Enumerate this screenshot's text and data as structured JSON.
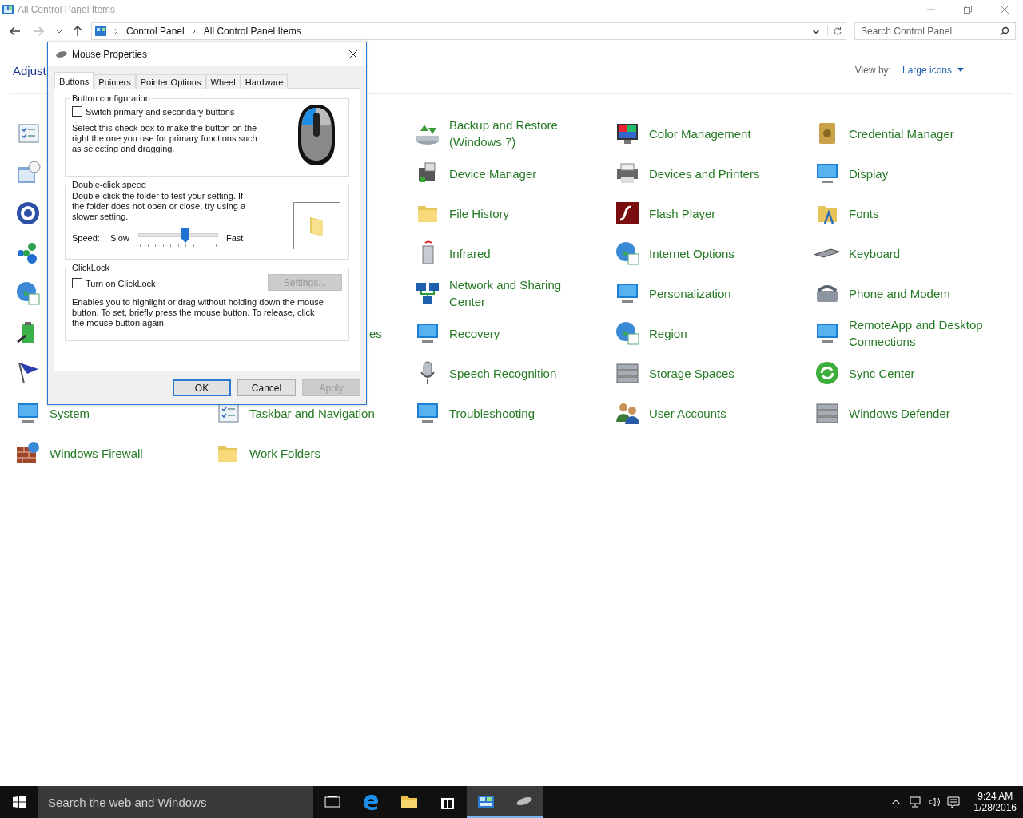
{
  "window": {
    "title": "All Control Panel Items"
  },
  "address_bar": {
    "path": [
      "Control Panel",
      "All Control Panel Items"
    ]
  },
  "search": {
    "placeholder": "Search Control Panel"
  },
  "heading": "Adjust",
  "view_by": {
    "label": "View by:",
    "value": "Large icons"
  },
  "rows": [
    {
      "cells": [
        {
          "kind": "icon_only"
        },
        {
          "kind": "covered"
        },
        {
          "kind": "item",
          "label": "Backup and Restore (Windows 7)"
        },
        {
          "kind": "item",
          "label": "Color Management"
        },
        {
          "kind": "item",
          "label": "Credential Manager"
        }
      ]
    },
    {
      "cells": [
        {
          "kind": "icon_only"
        },
        {
          "kind": "covered"
        },
        {
          "kind": "item",
          "label": "Device Manager"
        },
        {
          "kind": "item",
          "label": "Devices and Printers"
        },
        {
          "kind": "item",
          "label": "Display"
        }
      ]
    },
    {
      "cells": [
        {
          "kind": "icon_only"
        },
        {
          "kind": "covered"
        },
        {
          "kind": "item",
          "label": "File History"
        },
        {
          "kind": "item",
          "label": "Flash Player"
        },
        {
          "kind": "item",
          "label": "Fonts"
        }
      ]
    },
    {
      "cells": [
        {
          "kind": "icon_only"
        },
        {
          "kind": "covered"
        },
        {
          "kind": "item",
          "label": "Infrared"
        },
        {
          "kind": "item",
          "label": "Internet Options"
        },
        {
          "kind": "item",
          "label": "Keyboard"
        }
      ]
    },
    {
      "cells": [
        {
          "kind": "icon_only"
        },
        {
          "kind": "covered"
        },
        {
          "kind": "item",
          "label": "Network and Sharing Center"
        },
        {
          "kind": "item",
          "label": "Personalization"
        },
        {
          "kind": "item",
          "label": "Phone and Modem"
        }
      ]
    },
    {
      "cells": [
        {
          "kind": "icon_only"
        },
        {
          "kind": "cut_label",
          "label": "es"
        },
        {
          "kind": "item",
          "label": "Recovery"
        },
        {
          "kind": "item",
          "label": "Region"
        },
        {
          "kind": "item",
          "label": "RemoteApp and Desktop Connections"
        }
      ]
    },
    {
      "cells": [
        {
          "kind": "icon_only"
        },
        {
          "kind": "covered"
        },
        {
          "kind": "item",
          "label": "Speech Recognition"
        },
        {
          "kind": "item",
          "label": "Storage Spaces"
        },
        {
          "kind": "item",
          "label": "Sync Center"
        }
      ]
    },
    {
      "cells": [
        {
          "kind": "item",
          "label": "System"
        },
        {
          "kind": "item",
          "label": "Taskbar and Navigation"
        },
        {
          "kind": "item",
          "label": "Troubleshooting"
        },
        {
          "kind": "item",
          "label": "User Accounts"
        },
        {
          "kind": "item",
          "label": "Windows Defender"
        }
      ]
    },
    {
      "cells": [
        {
          "kind": "item",
          "label": "Windows Firewall"
        },
        {
          "kind": "item",
          "label": "Work Folders"
        }
      ]
    }
  ],
  "dialog": {
    "title": "Mouse Properties",
    "tabs": [
      {
        "label": "Buttons",
        "selected": true
      },
      {
        "label": "Pointers",
        "selected": false
      },
      {
        "label": "Pointer Options",
        "selected": false
      },
      {
        "label": "Wheel",
        "selected": false
      },
      {
        "label": "Hardware",
        "selected": false
      }
    ],
    "button_configuration": {
      "title": "Button configuration",
      "checkbox": {
        "label": "Switch primary and secondary buttons",
        "checked": false
      },
      "description": "Select this check box to make the button on the right the one you use for primary functions such as selecting and dragging."
    },
    "double_click_speed": {
      "title": "Double-click speed",
      "description": "Double-click the folder to test your setting. If the folder does not open or close, try using a slower setting.",
      "speed_label": "Speed:",
      "slow": "Slow",
      "fast": "Fast",
      "level": 0.59
    },
    "clicklock": {
      "title": "ClickLock",
      "checkbox": {
        "label": "Turn on ClickLock",
        "checked": false
      },
      "settings_button": {
        "label": "Settings...",
        "disabled": true
      },
      "description": "Enables you to highlight or drag without holding down the mouse button. To set, briefly press the mouse button. To release, click the mouse button again."
    },
    "buttons": [
      {
        "label": "OK",
        "default": true,
        "disabled": false
      },
      {
        "label": "Cancel",
        "default": false,
        "disabled": false
      },
      {
        "label": "Apply",
        "default": false,
        "disabled": true
      }
    ]
  },
  "taskbar": {
    "search_placeholder": "Search the web and Windows",
    "apps": [
      {
        "running": false
      },
      {
        "running": false
      },
      {
        "running": false
      },
      {
        "running": false
      },
      {
        "running": true
      },
      {
        "running": true
      }
    ],
    "time": "9:24 AM",
    "date": "1/28/2016"
  }
}
